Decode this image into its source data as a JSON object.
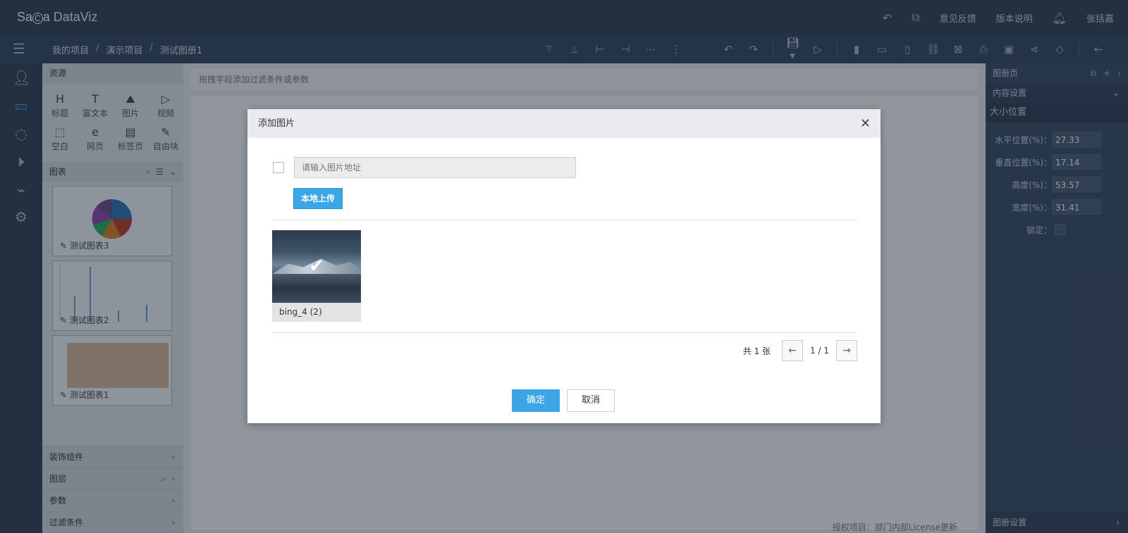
{
  "app": {
    "logo_prefix": "Sa",
    "logo_mid": "C",
    "logo_a": "a",
    "logo_suffix": " DataViz"
  },
  "topbar": {
    "feedback": "意见反馈",
    "version_notes": "版本说明",
    "user": "张括嘉"
  },
  "breadcrumb": [
    "我的项目",
    "演示项目",
    "测试图册1"
  ],
  "breadcrumb_sep": "/",
  "left_panel": {
    "resources_title": "资源",
    "resources": [
      {
        "icon": "H",
        "label": "标题"
      },
      {
        "icon": "T",
        "label": "富文本"
      },
      {
        "icon": "⛰",
        "label": "图片"
      },
      {
        "icon": "▷",
        "label": "视频"
      },
      {
        "icon": "⬚",
        "label": "空白"
      },
      {
        "icon": "e",
        "label": "网页"
      },
      {
        "icon": "▤",
        "label": "标签页"
      },
      {
        "icon": "✎",
        "label": "自由块"
      }
    ],
    "charts_title": "图表",
    "charts": [
      {
        "label": "测试图表3"
      },
      {
        "label": "测试图表2"
      },
      {
        "label": "测试图表1"
      }
    ],
    "sections": [
      "装饰组件",
      "图层",
      "参数",
      "过滤条件"
    ]
  },
  "canvas": {
    "filter_placeholder": "拖拽字段添加过滤条件或参数",
    "license_text": "授权项目：部门内部License更新"
  },
  "right_panel": {
    "title": "图册页",
    "content_settings": "内容设置",
    "size_position": "大小位置",
    "fields": [
      {
        "label": "水平位置(%)：",
        "value": "27.33"
      },
      {
        "label": "垂直位置(%)：",
        "value": "17.14"
      },
      {
        "label": "高度(%)：",
        "value": "53.57"
      },
      {
        "label": "宽度(%)：",
        "value": "31.41"
      }
    ],
    "lock_label": "锁定：",
    "footer": "图册设置"
  },
  "modal": {
    "title": "添加图片",
    "url_placeholder": "请输入图片地址",
    "upload_label": "本地上传",
    "image_name": "bing_4 (2)",
    "total_label": "共 1 张",
    "page_label": "1 / 1",
    "confirm_label": "确定",
    "cancel_label": "取消"
  },
  "colors": {
    "accent": "#3aa6e8",
    "topbar": "#2f3e55"
  }
}
